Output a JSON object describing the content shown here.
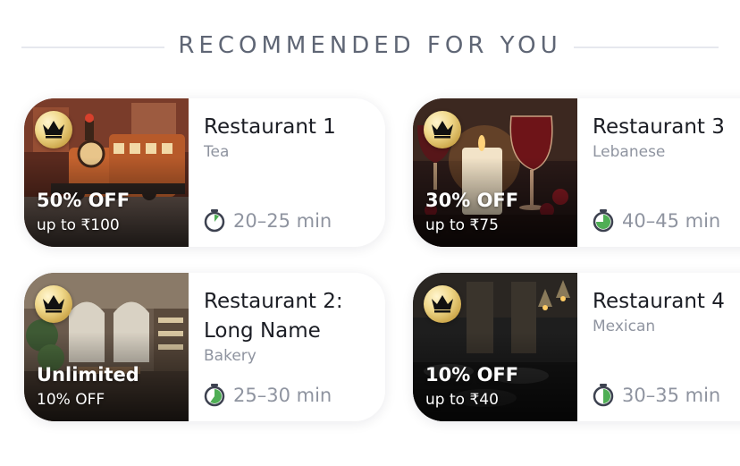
{
  "section": {
    "title": "RECOMMENDED FOR YOU"
  },
  "restaurants": [
    {
      "name": "Restaurant 1",
      "cuisine": "Tea",
      "offer_title": "50% OFF",
      "offer_sub": "up to ₹100",
      "eta": "20–25 min",
      "photo_icon": "toy-train-photo",
      "eta_progress": 0.15
    },
    {
      "name": "Restaurant 3",
      "cuisine": "Lebanese",
      "offer_title": "30% OFF",
      "offer_sub": "up to ₹75",
      "eta": "40–45 min",
      "photo_icon": "wine-candle-photo",
      "eta_progress": 0.75
    },
    {
      "name": "Restaurant 2: Long Name",
      "cuisine": "Bakery",
      "offer_title": "Unlimited",
      "offer_sub": "10% OFF",
      "eta": "25–30 min",
      "photo_icon": "bakery-interior-photo",
      "eta_progress": 0.6
    },
    {
      "name": "Restaurant 4",
      "cuisine": "Mexican",
      "offer_title": "10% OFF",
      "offer_sub": "up to ₹40",
      "eta": "30–35 min",
      "photo_icon": "dark-restaurant-photo",
      "eta_progress": 0.5
    }
  ],
  "colors": {
    "eta_fill": "#4fae55",
    "eta_ring": "#3d4250",
    "badge_gold": "#d8b65a"
  }
}
